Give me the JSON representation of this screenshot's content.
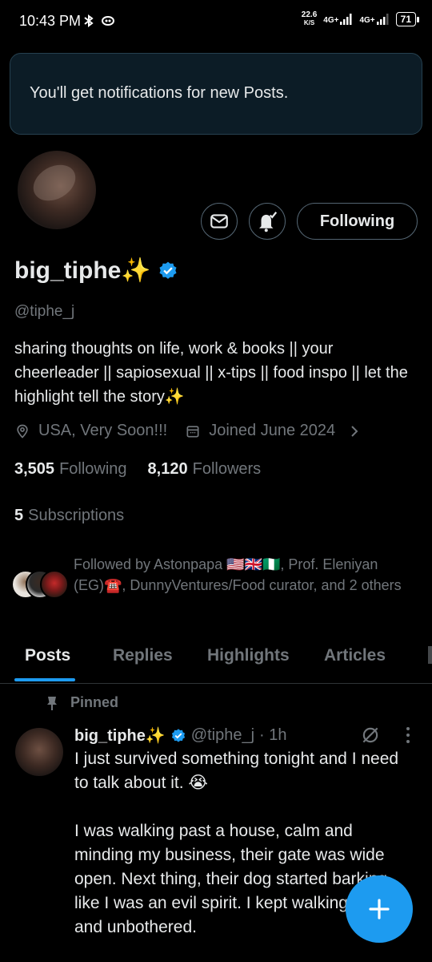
{
  "status_bar": {
    "time": "10:43 PM",
    "speed_value": "22.6",
    "speed_unit": "K/S",
    "network_1": "4G+",
    "network_2": "4G+",
    "battery": "71"
  },
  "toast": {
    "message": "You'll get notifications for new Posts."
  },
  "profile": {
    "display_name": "big_tiphe✨",
    "verified": true,
    "handle": "@tiphe_j",
    "bio": "sharing thoughts on life, work & books || your cheerleader || sapiosexual || x-tips || food inspo || let the highlight tell the story✨",
    "location": "USA, Very Soon!!!",
    "joined": "Joined June 2024",
    "following_count": "3,505",
    "following_label": "Following",
    "followers_count": "8,120",
    "followers_label": "Followers",
    "subscriptions_count": "5",
    "subscriptions_label": "Subscriptions",
    "followed_by": "Followed by Astonpapa 🇺🇸🇬🇧🇳🇬, Prof. Eleniyan (EG)☎️, DunnyVentures/Food curator, and 2 others"
  },
  "actions": {
    "follow_button": "Following"
  },
  "tabs": [
    {
      "label": "Posts",
      "active": true
    },
    {
      "label": "Replies",
      "active": false
    },
    {
      "label": "Highlights",
      "active": false
    },
    {
      "label": "Articles",
      "active": false
    }
  ],
  "post": {
    "pinned_label": "Pinned",
    "author_name": "big_tiphe✨",
    "author_handle": "@tiphe_j",
    "time": "· 1h",
    "text": "I just survived something tonight and I need to talk about it. 😭\n\nI was walking past a house, calm and minding my business, their gate was wide open. Next thing, their dog started barking like I was an evil spirit. I kept walking, cool and unbothered."
  },
  "colors": {
    "accent": "#1d9bf0",
    "background": "#000000",
    "secondary_text": "#71767b",
    "border": "#536471"
  },
  "icons": {
    "message": "envelope-icon",
    "notifications": "bell-check-icon",
    "location": "location-pin-icon",
    "calendar": "calendar-icon",
    "chevron": "chevron-right-icon",
    "pin": "pin-icon",
    "grok": "grok-icon",
    "more": "more-vertical-icon",
    "compose": "plus-icon",
    "verified": "verified-badge-icon"
  }
}
